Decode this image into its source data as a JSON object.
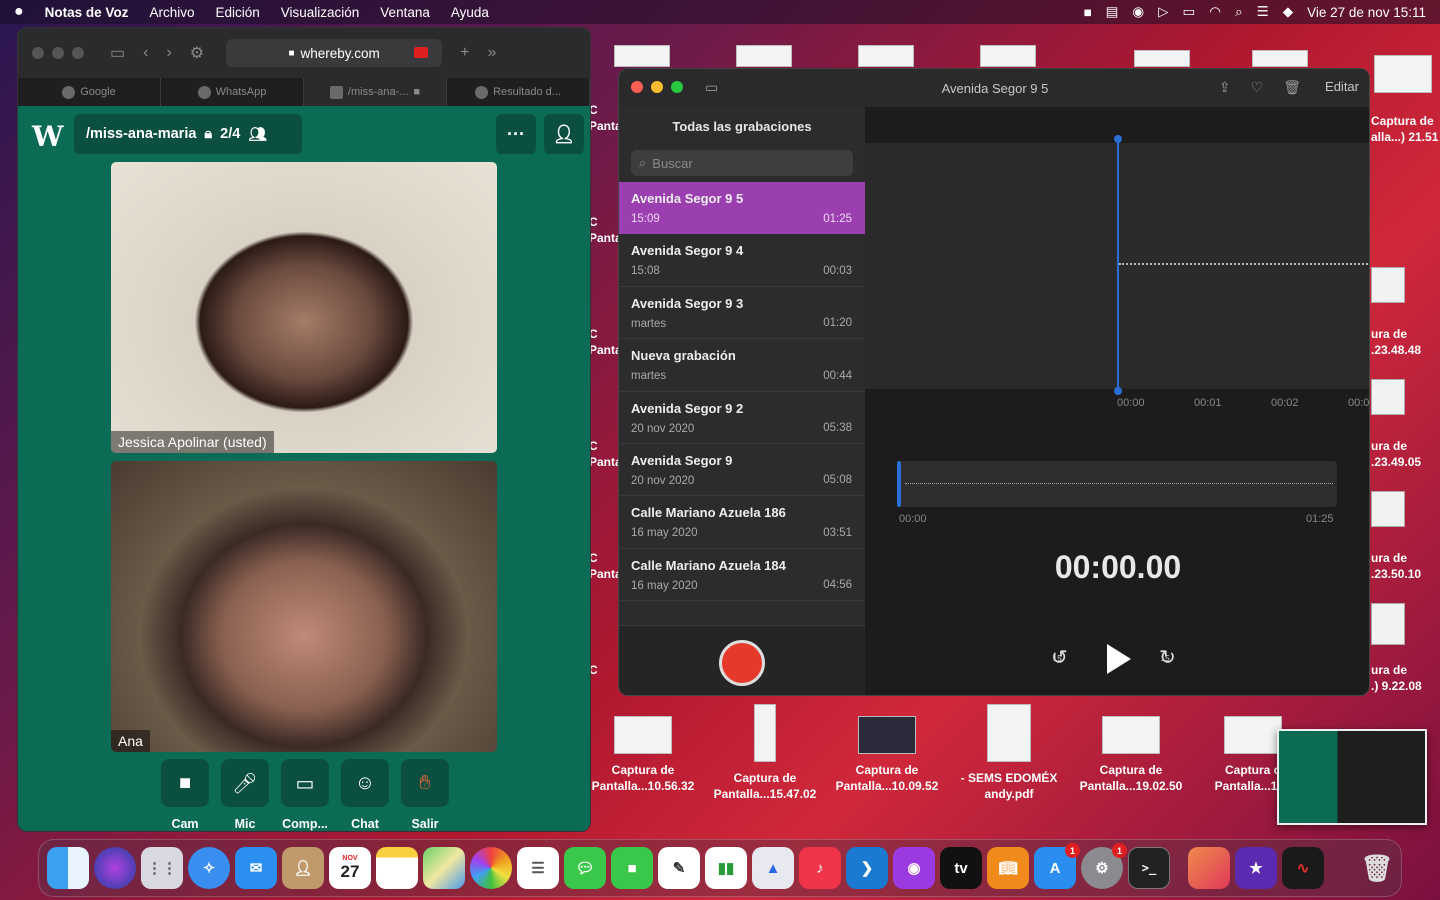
{
  "menubar": {
    "app": "Notas de Voz",
    "items": [
      "Archivo",
      "Edición",
      "Visualización",
      "Ventana",
      "Ayuda"
    ],
    "clock": "Vie 27 de nov  15:11"
  },
  "safari": {
    "url": "whereby.com",
    "tabs": [
      "Google",
      "WhatsApp",
      "/miss-ana-...",
      "Resultado d..."
    ],
    "room": {
      "name": "/miss-ana-maria",
      "count": "2/4"
    },
    "participants": [
      {
        "name": "Jessica Apolinar (usted)"
      },
      {
        "name": "Ana"
      }
    ],
    "controls": [
      "Cam",
      "Mic",
      "Comp...",
      "Chat",
      "Salir"
    ]
  },
  "voice_memos": {
    "title": "Avenida Segor 9 5",
    "edit": "Editar",
    "sidebar_title": "Todas las grabaciones",
    "search_placeholder": "Buscar",
    "recordings": [
      {
        "name": "Avenida Segor 9 5",
        "date": "15:09",
        "duration": "01:25"
      },
      {
        "name": "Avenida Segor 9 4",
        "date": "15:08",
        "duration": "00:03"
      },
      {
        "name": "Avenida Segor 9 3",
        "date": "martes",
        "duration": "01:20"
      },
      {
        "name": "Nueva grabación",
        "date": "martes",
        "duration": "00:44"
      },
      {
        "name": "Avenida Segor 9 2",
        "date": "20 nov 2020",
        "duration": "05:38"
      },
      {
        "name": "Avenida Segor 9",
        "date": "20 nov 2020",
        "duration": "05:08"
      },
      {
        "name": "Calle Mariano Azuela 186",
        "date": "16 may 2020",
        "duration": "03:51"
      },
      {
        "name": "Calle Mariano Azuela 184",
        "date": "16 may 2020",
        "duration": "04:56"
      }
    ],
    "ticks": [
      "00:00",
      "00:01",
      "00:02",
      "00:0"
    ],
    "scrub_start": "00:00",
    "scrub_end": "01:25",
    "timer": "00:00.00",
    "skip": "15"
  },
  "desktop": {
    "icons": [
      {
        "l1": "Captura de",
        "l2": "Pantalla...10.56.32"
      },
      {
        "l1": "Captura de",
        "l2": "Pantalla...15.47.02"
      },
      {
        "l1": "Captura de",
        "l2": "Pantalla...10.09.52"
      },
      {
        "l1": "- SEMS EDOMÉX",
        "l2": "andy.pdf"
      },
      {
        "l1": "Captura de",
        "l2": "Pantalla...19.02.50"
      },
      {
        "l1": "Captura d",
        "l2": "Pantalla...18.:"
      }
    ],
    "right_labels": [
      {
        "l1": "Captura de",
        "l2": "alla...) 21.51"
      },
      {
        "l1": "ura de",
        "l2": ".23.48.48"
      },
      {
        "l1": "ura de",
        "l2": ".23.49.05"
      },
      {
        "l1": "ura de",
        "l2": ".23.50.10"
      },
      {
        "l1": "ura de",
        "l2": ".) 9.22.08"
      }
    ],
    "edge_labels": [
      "C",
      "Panta"
    ]
  },
  "dock": {
    "calendar_month": "NOV",
    "calendar_day": "27",
    "tv": "tv",
    "badge": "1"
  }
}
